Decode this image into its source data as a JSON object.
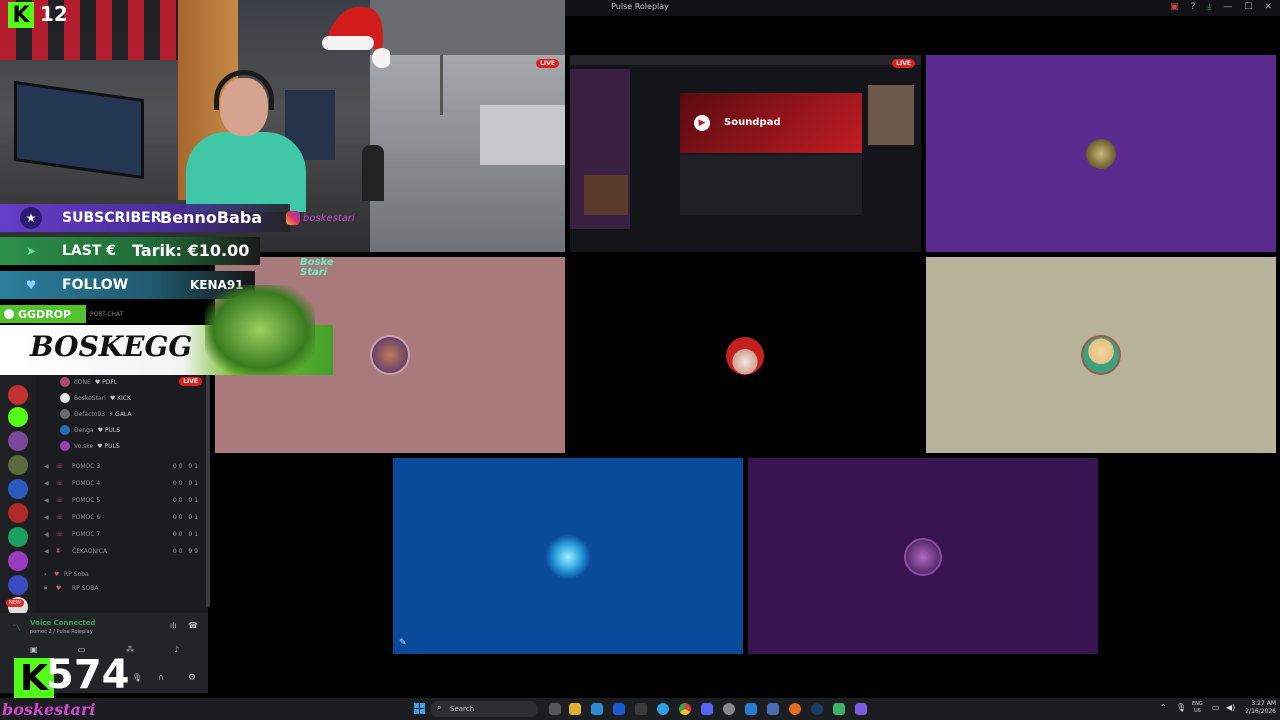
{
  "window": {
    "title": "Pulse Roleplay"
  },
  "tiles": {
    "live_label": "LIVE",
    "screenshare": {
      "app_title": "Soundpad"
    }
  },
  "overlay": {
    "kick_count_top": "12",
    "alerts": [
      {
        "key": "SUBSCRIBER",
        "value": "BennoBaba",
        "color": "#6a3fd9"
      },
      {
        "key": "LAST €",
        "value": "Tarik: €10.00",
        "color": "#2d8f4a"
      },
      {
        "key": "FOLLOW",
        "value": "KENA91",
        "color": "#2a7f9c"
      }
    ],
    "instagram_handle": "boskestari",
    "sticker_text": "Boske Stari",
    "ggdrop_label": "GGDROP",
    "banner_name": "BOSKEGG",
    "kick_count_bottom": "574",
    "channel_handle": "boskestari"
  },
  "discord": {
    "header_fragment": "PORT-CHAT",
    "voice_users": [
      {
        "name": "dONE",
        "tag": "♥ PDFL",
        "color": "#b04a6a"
      },
      {
        "name": "BoskeStari",
        "tag": "♥ KICK",
        "color": "#e8e8e8"
      },
      {
        "name": "Defacto93",
        "tag": "⚡ GALA",
        "color": "#6b6b6b"
      },
      {
        "name": "Denga",
        "tag": "♥ PULS",
        "color": "#1f6fb3"
      },
      {
        "name": "Vo.ske",
        "tag": "♥ PULS",
        "color": "#9a3fb0"
      }
    ],
    "channels": [
      {
        "name": "POMOC 3",
        "count": "00 01"
      },
      {
        "name": "POMOC 4",
        "count": "00 01"
      },
      {
        "name": "POMOC 5",
        "count": "00 01"
      },
      {
        "name": "POMOC 6",
        "count": "00 01"
      },
      {
        "name": "POMOC 7",
        "count": "00 01"
      },
      {
        "name": "ČEKAONICA",
        "count": "00 99"
      }
    ],
    "category": "RP Soba",
    "locked_channel": "RP SOBA",
    "voice_status": "Voice Connected",
    "voice_location": "pomoc 2 / Pulse Roleplay",
    "new_badge": "NEW"
  },
  "taskbar": {
    "search_label": "Search",
    "lang": "ENG",
    "region": "US",
    "time": "3:27 AM",
    "date": "2/16/2026"
  },
  "colors": {
    "tile_purple": "#5b2a8e",
    "tile_rose": "#a87a7b",
    "tile_black": "#000000",
    "tile_beige": "#b7b29a",
    "tile_blue": "#0a4a9a",
    "tile_plum": "#3a1450",
    "discord_green": "#3ba55d"
  }
}
